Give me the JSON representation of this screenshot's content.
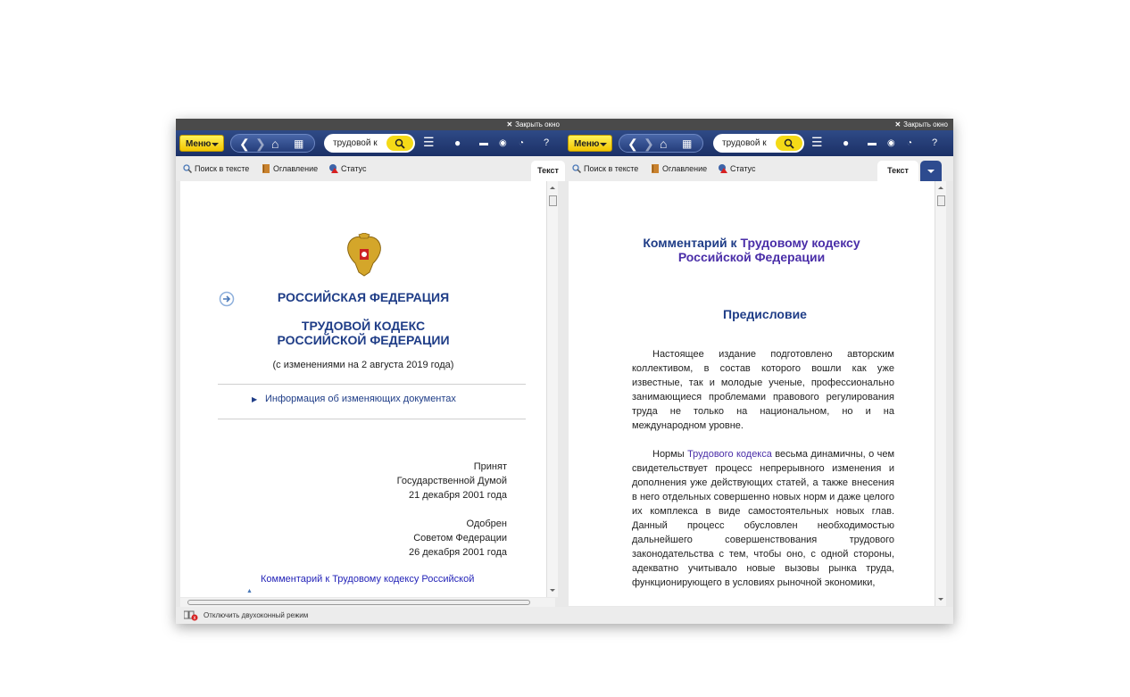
{
  "window": {
    "close_label": "Закрыть окно",
    "toggle_mode_label": "Отключить двухоконный режим"
  },
  "toolbar": {
    "menu_label": "Меню",
    "search_value_left": "трудовой к",
    "search_value_right": "трудовой к"
  },
  "tabs": {
    "search_in_text": "Поиск в тексте",
    "contents": "Оглавление",
    "status": "Статус",
    "text": "Текст"
  },
  "left_doc": {
    "heading1": "РОССИЙСКАЯ ФЕДЕРАЦИЯ",
    "heading2": "ТРУДОВОЙ КОДЕКС РОССИЙСКОЙ ФЕДЕРАЦИИ",
    "amended": "(с изменениями на 2 августа 2019 года)",
    "info_link": "Информация об изменяющих документах",
    "adopted_1": "Принят",
    "adopted_2": "Государственной Думой",
    "adopted_3": "21 декабря 2001 года",
    "approved_1": "Одобрен",
    "approved_2": "Советом Федерации",
    "approved_3": "26 декабря 2001 года",
    "comment_link": "Комментарий к Трудовому кодексу Российской"
  },
  "right_doc": {
    "title_prefix": "Комментарий к ",
    "title_link": "Трудовому кодексу",
    "title_line2": "Российской Федерации",
    "preface": "Предисловие",
    "para1": "Настоящее издание подготовлено авторским коллективом, в состав которого вошли как уже известные, так и молодые ученые, профессионально занимающиеся проблемами правового регулирования труда не только на национальном, но и на международном уровне.",
    "para2_start": "Нормы ",
    "para2_link": "Трудового кодекса",
    "para2_rest": " весьма динамичны, о чем свидетельствует процесс непрерывного изменения и дополнения уже действующих статей, а также внесения в него отдельных совершенно новых норм и даже целого их комплекса в виде самостоятельных новых глав. Данный процесс обусловлен необходимостью дальнейшего совершенствования трудового законодательства с тем, чтобы оно, с одной стороны, адекватно учитывало новые вызовы рынка труда, функционирующего в условиях рыночной экономики,"
  },
  "colors": {
    "toolbar": "#1f3570",
    "menu": "#f2c500",
    "heading": "#1f3d87",
    "link": "#4a2ea8"
  }
}
